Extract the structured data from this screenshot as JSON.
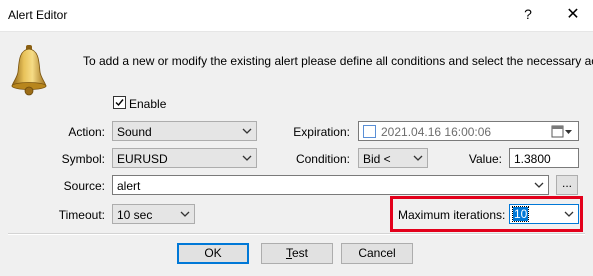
{
  "window": {
    "title": "Alert Editor",
    "help_glyph": "?",
    "close_glyph": "✕"
  },
  "intro": "To add a new or modify the existing alert please define all conditions and select the necessary action.",
  "enable": {
    "label": "Enable",
    "checked": true
  },
  "action": {
    "label": "Action:",
    "value": "Sound"
  },
  "expiration": {
    "label": "Expiration:",
    "value": "2021.04.16 16:00:06",
    "checked": false
  },
  "symbol": {
    "label": "Symbol:",
    "value": "EURUSD"
  },
  "condition": {
    "label": "Condition:",
    "value": "Bid <"
  },
  "value_field": {
    "label": "Value:",
    "value": "1.3800"
  },
  "source": {
    "label": "Source:",
    "value": "alert",
    "browse_label": "..."
  },
  "timeout": {
    "label": "Timeout:",
    "value": "10 sec"
  },
  "max_iterations": {
    "label": "Maximum iterations:",
    "value": "10"
  },
  "buttons": {
    "ok": "OK",
    "test_prefix": "T",
    "test_rest": "est",
    "cancel": "Cancel"
  },
  "colors": {
    "highlight": "#e3001b",
    "selection": "#0078d7",
    "bell": "#c79a2e"
  },
  "icons": {
    "bell": "bell-icon",
    "calendar": "calendar-icon"
  }
}
